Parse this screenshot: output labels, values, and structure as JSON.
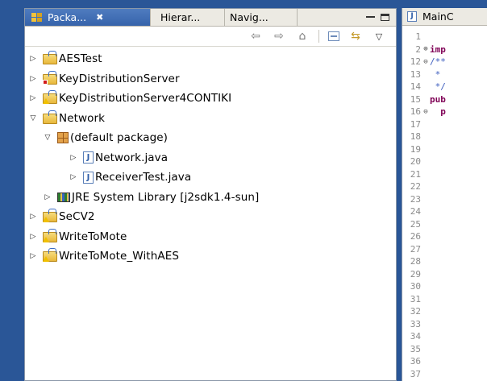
{
  "package_explorer": {
    "tabs": [
      {
        "label": "Packa...",
        "active": true,
        "close": "✖"
      },
      {
        "label": "Hierar..."
      },
      {
        "label": "Navig..."
      }
    ],
    "tree": [
      {
        "indent": 0,
        "twisty": "▷",
        "icon": "project",
        "marker": "",
        "label": "AESTest"
      },
      {
        "indent": 0,
        "twisty": "▷",
        "icon": "project",
        "marker": "error",
        "label": "KeyDistributionServer"
      },
      {
        "indent": 0,
        "twisty": "▷",
        "icon": "project",
        "marker": "warning",
        "label": "KeyDistributionServer4CONTIKI"
      },
      {
        "indent": 0,
        "twisty": "▽",
        "icon": "project",
        "marker": "",
        "label": "Network"
      },
      {
        "indent": 1,
        "twisty": "▽",
        "icon": "package",
        "marker": "",
        "label": "(default package)"
      },
      {
        "indent": 2,
        "twisty": "▷",
        "icon": "java",
        "marker": "",
        "label": "Network.java"
      },
      {
        "indent": 2,
        "twisty": "▷",
        "icon": "java",
        "marker": "",
        "label": "ReceiverTest.java"
      },
      {
        "indent": 1,
        "twisty": "▷",
        "icon": "library",
        "marker": "",
        "label": "JRE System Library [j2sdk1.4-sun]"
      },
      {
        "indent": 0,
        "twisty": "▷",
        "icon": "project",
        "marker": "warning",
        "label": "SeCV2"
      },
      {
        "indent": 0,
        "twisty": "▷",
        "icon": "project",
        "marker": "warning",
        "label": "WriteToMote"
      },
      {
        "indent": 0,
        "twisty": "▷",
        "icon": "project",
        "marker": "warning",
        "label": "WriteToMote_WithAES"
      }
    ],
    "toolbar_icons": [
      "back-arrow-icon",
      "forward-arrow-icon",
      "link-with-editor-icon",
      "collapse-all-icon",
      "sync-icon",
      "view-menu-icon"
    ]
  },
  "editor": {
    "tab_label": "MainC",
    "lines": [
      {
        "n": "1",
        "fold": "",
        "text": "",
        "kind": ""
      },
      {
        "n": "2",
        "fold": "⊕",
        "text": "imp",
        "kind": "kw"
      },
      {
        "n": "12",
        "fold": "⊖",
        "text": "/**",
        "kind": "cmt"
      },
      {
        "n": "13",
        "fold": "",
        "text": " *",
        "kind": "cmt"
      },
      {
        "n": "14",
        "fold": "",
        "text": " */",
        "kind": "cmt"
      },
      {
        "n": "15",
        "fold": "",
        "text": "pub",
        "kind": "kw"
      },
      {
        "n": "16",
        "fold": "⊖",
        "text": "  p",
        "kind": "kw"
      },
      {
        "n": "17",
        "fold": "",
        "text": "",
        "kind": ""
      },
      {
        "n": "18",
        "fold": "",
        "text": "",
        "kind": ""
      },
      {
        "n": "19",
        "fold": "",
        "text": "",
        "kind": ""
      },
      {
        "n": "20",
        "fold": "",
        "text": "",
        "kind": ""
      },
      {
        "n": "21",
        "fold": "",
        "text": "",
        "kind": ""
      },
      {
        "n": "22",
        "fold": "",
        "text": "",
        "kind": ""
      },
      {
        "n": "23",
        "fold": "",
        "text": "",
        "kind": ""
      },
      {
        "n": "24",
        "fold": "",
        "text": "",
        "kind": ""
      },
      {
        "n": "25",
        "fold": "",
        "text": "",
        "kind": ""
      },
      {
        "n": "26",
        "fold": "",
        "text": "",
        "kind": ""
      },
      {
        "n": "27",
        "fold": "",
        "text": "",
        "kind": ""
      },
      {
        "n": "28",
        "fold": "",
        "text": "",
        "kind": ""
      },
      {
        "n": "29",
        "fold": "",
        "text": "",
        "kind": ""
      },
      {
        "n": "30",
        "fold": "",
        "text": "",
        "kind": ""
      },
      {
        "n": "31",
        "fold": "",
        "text": "",
        "kind": ""
      },
      {
        "n": "32",
        "fold": "",
        "text": "",
        "kind": ""
      },
      {
        "n": "33",
        "fold": "",
        "text": "",
        "kind": ""
      },
      {
        "n": "34",
        "fold": "",
        "text": "",
        "kind": ""
      },
      {
        "n": "35",
        "fold": "",
        "text": "",
        "kind": ""
      },
      {
        "n": "36",
        "fold": "",
        "text": "",
        "kind": ""
      },
      {
        "n": "37",
        "fold": "",
        "text": "",
        "kind": ""
      }
    ]
  },
  "colors": {
    "desktop": "#2a5697",
    "active_tab": "#3f6db4",
    "keyword": "#7f0055",
    "comment": "#3f5fbf"
  }
}
